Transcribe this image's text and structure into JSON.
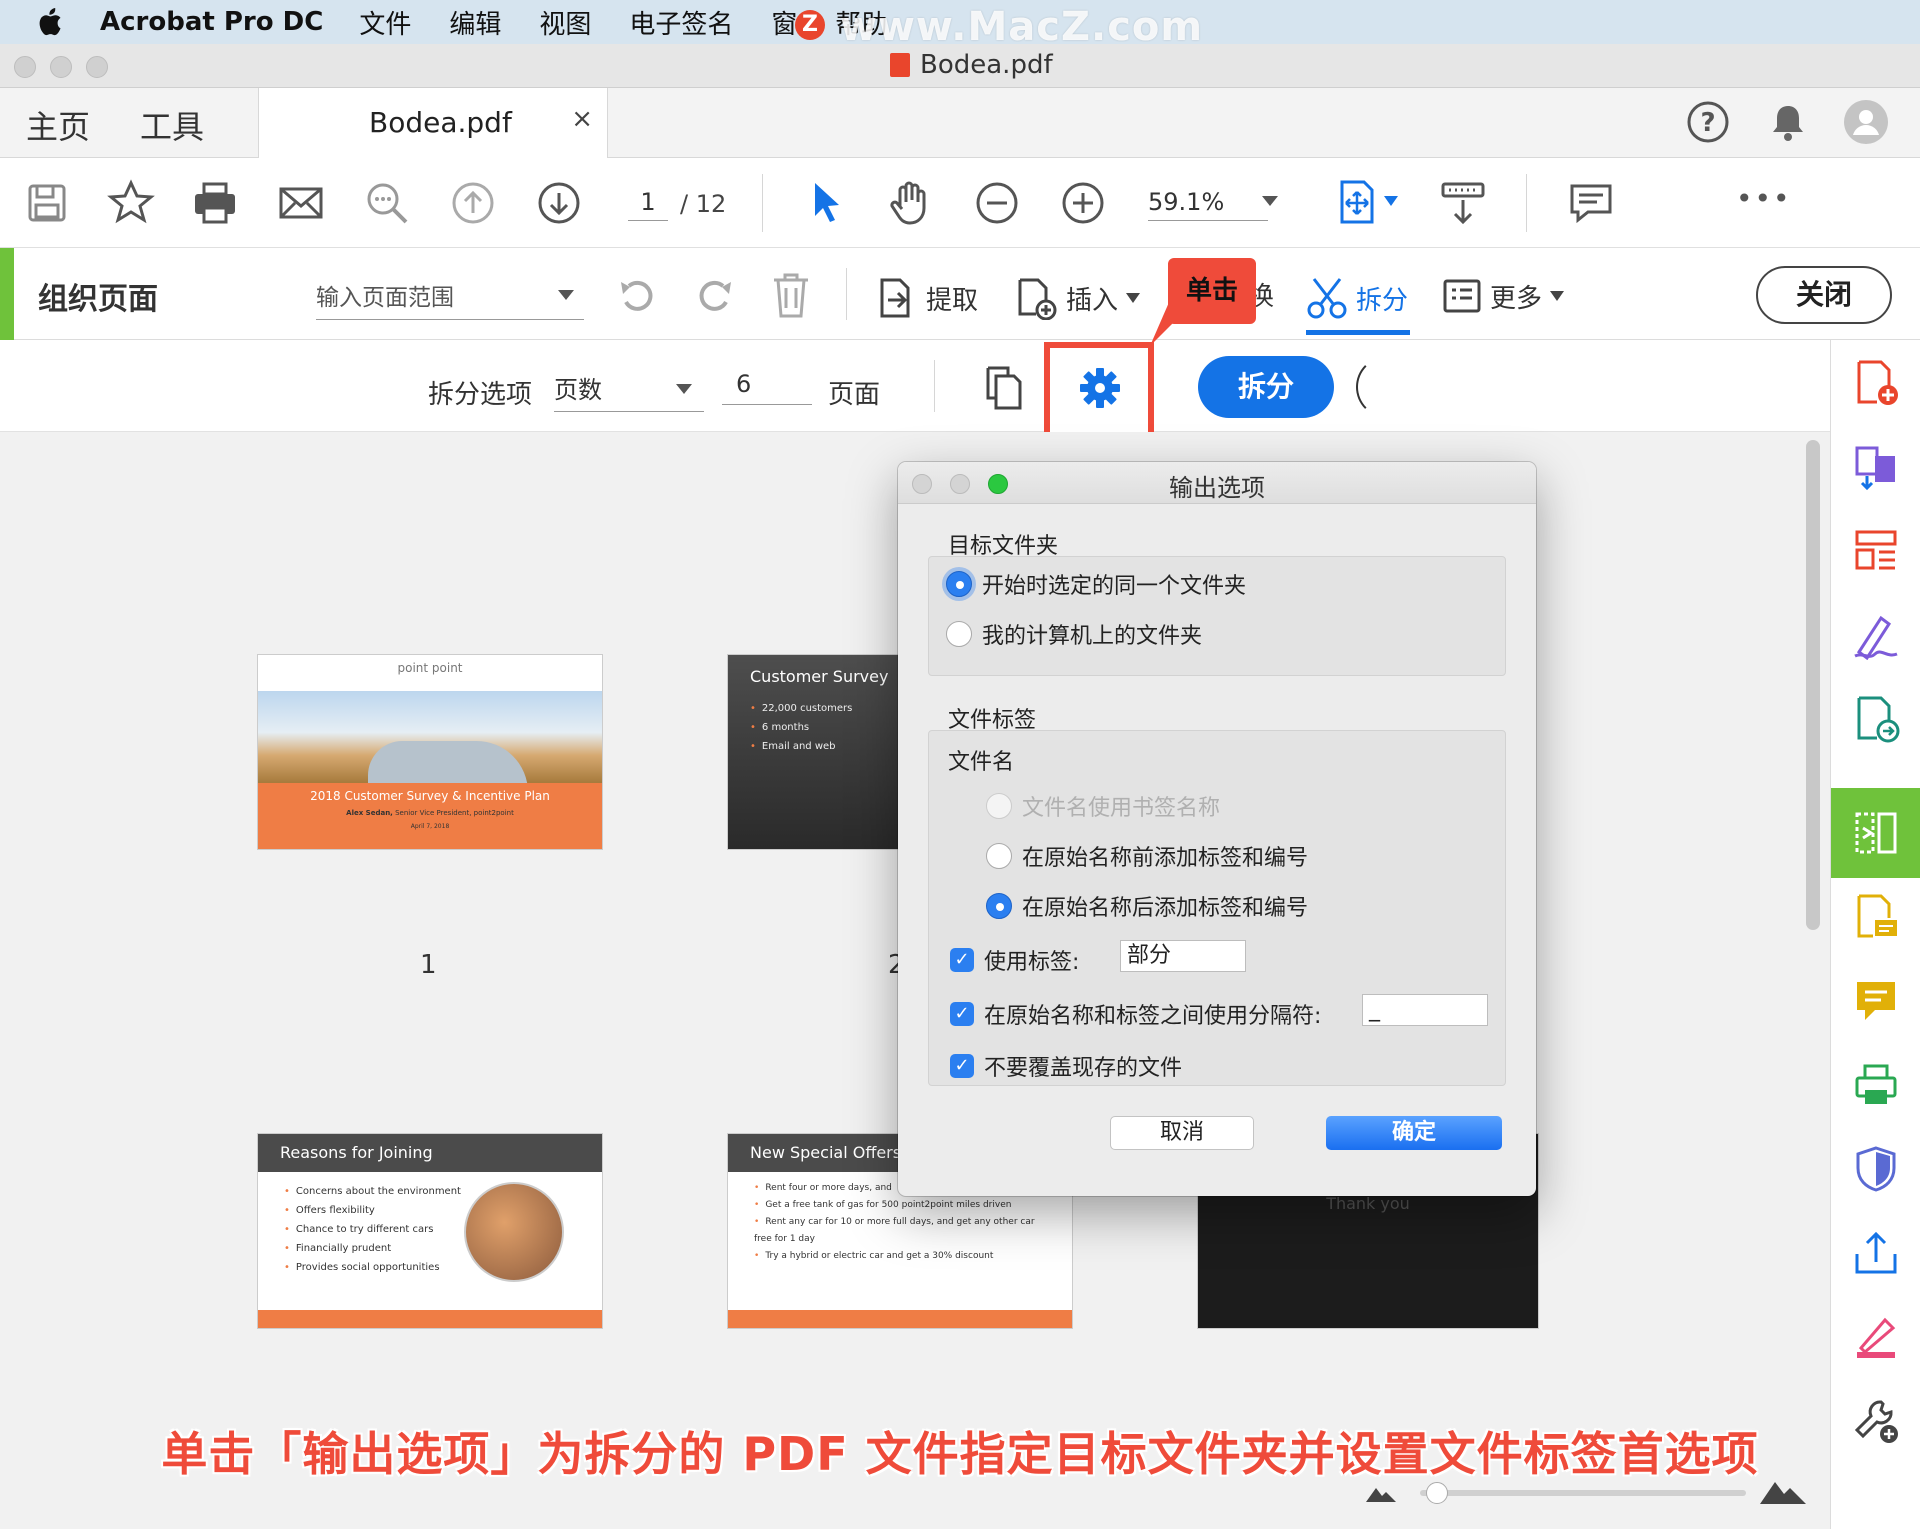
{
  "menubar": {
    "app_name": "Acrobat Pro DC",
    "items": [
      "文件",
      "编辑",
      "视图",
      "电子签名",
      "窗",
      "帮助"
    ],
    "watermark": "www.MacZ.com",
    "watermark_logo": "Z"
  },
  "window": {
    "title": "Bodea.pdf"
  },
  "tabs": {
    "home": "主页",
    "tools": "工具",
    "doc": "Bodea.pdf",
    "close": "×"
  },
  "toolbar": {
    "page_current": "1",
    "page_total": "/ 12",
    "zoom": "59.1%",
    "more": "•••"
  },
  "organize": {
    "title": "组织页面",
    "range_placeholder": "输入页面范围",
    "extract": "提取",
    "insert": "插入",
    "replace_partial": "换",
    "split": "拆分",
    "more": "更多",
    "close": "关闭"
  },
  "callout": {
    "text": "单击"
  },
  "split_options": {
    "label": "拆分选项",
    "by": "页数",
    "count": "6",
    "unit": "页面",
    "split_button": "拆分"
  },
  "thumbnails": {
    "page_numbers": [
      "1",
      "2"
    ],
    "slide1": {
      "logo": "point point",
      "title": "2018 Customer Survey & Incentive Plan",
      "subtitle_name": "Alex Sedan,",
      "subtitle_role": "Senior Vice President, point2point",
      "date": "April 7, 2018"
    },
    "slide2": {
      "title": "Customer Survey",
      "bullets": [
        "22,000 customers",
        "6 months",
        "Email and web"
      ]
    },
    "slide3": {
      "title": "Reasons for Joining",
      "bullets": [
        "Concerns about the environment",
        "Offers flexibility",
        "Chance to try different cars",
        "Financially prudent",
        "Provides social opportunities"
      ]
    },
    "slide4": {
      "title": "New Special Offers",
      "bullets": [
        "Rent four or more days, and",
        "Get a free tank of gas for 500 point2point miles driven",
        "Rent any car for 10 or more full days, and get any other car free for 1 day",
        "Try a hybrid or electric car and get a 30% discount"
      ]
    },
    "slide5": {
      "title": "Thank you"
    }
  },
  "dialog": {
    "title": "输出选项",
    "target_folder_label": "目标文件夹",
    "opt_same_folder": "开始时选定的同一个文件夹",
    "opt_my_computer": "我的计算机上的文件夹",
    "file_label_section": "文件标签",
    "file_name_label": "文件名",
    "opt_bookmark_name": "文件名使用书签名称",
    "opt_prefix": "在原始名称前添加标签和编号",
    "opt_suffix": "在原始名称后添加标签和编号",
    "use_label": "使用标签:",
    "label_value": "部分",
    "use_separator": "在原始名称和标签之间使用分隔符:",
    "separator_value": "_",
    "no_overwrite": "不要覆盖现存的文件",
    "cancel": "取消",
    "ok": "确定"
  },
  "caption": "单击「输出选项」为拆分的 PDF 文件指定目标文件夹并设置文件标签首选项",
  "colors": {
    "accent_blue": "#1473e6",
    "organize_green": "#6fc23b",
    "highlight_red": "#ef4b3a"
  }
}
